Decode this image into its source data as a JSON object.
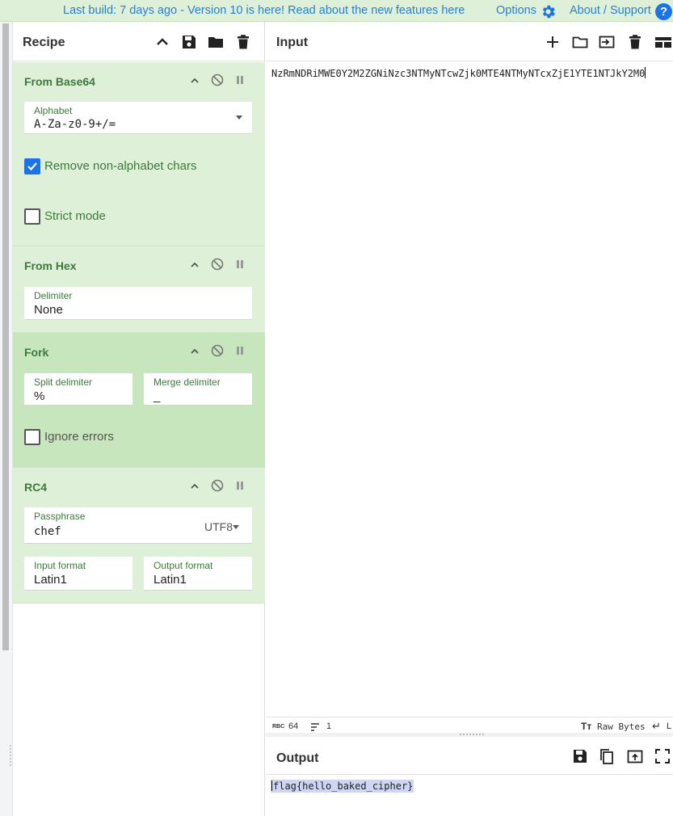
{
  "banner": {
    "message": "Last build: 7 days ago - Version 10 is here! Read about the new features here",
    "options_label": "Options",
    "about_label": "About / Support",
    "help_glyph": "?"
  },
  "recipe": {
    "title": "Recipe",
    "operations": {
      "from_base64": {
        "name": "From Base64",
        "alphabet_label": "Alphabet",
        "alphabet_value": "A-Za-z0-9+/=",
        "remove_label": "Remove non-alphabet chars",
        "remove_checked": true,
        "strict_label": "Strict mode",
        "strict_checked": false
      },
      "from_hex": {
        "name": "From Hex",
        "delimiter_label": "Delimiter",
        "delimiter_value": "None"
      },
      "fork": {
        "name": "Fork",
        "split_label": "Split delimiter",
        "split_value": "%",
        "merge_label": "Merge delimiter",
        "merge_value": "_",
        "ignore_label": "Ignore errors",
        "ignore_checked": false
      },
      "rc4": {
        "name": "RC4",
        "passphrase_label": "Passphrase",
        "passphrase_value": "chef",
        "passphrase_encoding": "UTF8",
        "input_format_label": "Input format",
        "input_format_value": "Latin1",
        "output_format_label": "Output format",
        "output_format_value": "Latin1"
      }
    }
  },
  "input": {
    "title": "Input",
    "text": "NzRmNDRiMWE0Y2M2ZGNiNzc3NTMyNTcwZjk0MTE4NTMyNTcxZjE1YTE1NTJkY2M0",
    "status": {
      "length_badge": "RBC",
      "length": "64",
      "lines": "1",
      "raw_bytes_label": "Raw Bytes",
      "eol_label": "L"
    }
  },
  "output": {
    "title": "Output",
    "text": "flag{hello_baked_cipher}"
  },
  "colors": {
    "accent_blue": "#1a73e8",
    "op_green_bg": "#dff0d8",
    "fork_green_bg": "#c8e6be",
    "op_green_text": "#3c7a3c"
  }
}
